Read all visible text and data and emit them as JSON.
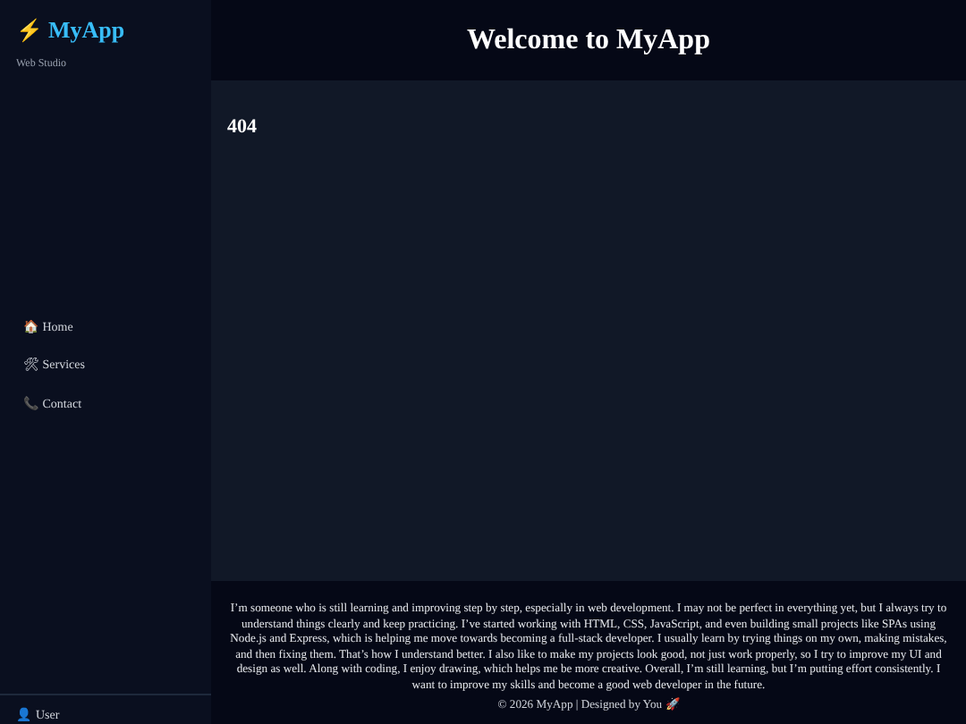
{
  "sidebar": {
    "logo_icon": "⚡",
    "logo": "MyApp",
    "tagline": "Web Studio",
    "items": [
      {
        "icon": "🏠",
        "label": "Home"
      },
      {
        "icon": "🛠",
        "label": "Services"
      },
      {
        "icon": "📞",
        "label": "Contact"
      }
    ],
    "user": {
      "icon": "👤",
      "label": "User"
    }
  },
  "header": {
    "title": "Welcome to MyApp"
  },
  "main": {
    "heading": "404"
  },
  "footer": {
    "about": "I’m someone who is still learning and improving step by step, especially in web development. I may not be perfect in everything yet, but I always try to understand things clearly and keep practicing. I’ve started working with HTML, CSS, JavaScript, and even building small projects like SPAs using Node.js and Express, which is helping me move towards becoming a full-stack developer. I usually learn by trying things on my own, making mistakes, and then fixing them. That’s how I understand better. I also like to make my projects look good, not just work properly, so I try to improve my UI and design as well. Along with coding, I enjoy drawing, which helps me be more creative. Overall, I’m still learning, but I’m putting effort consistently. I want to improve my skills and become a good web developer in the future.",
    "copyright": "© 2026 MyApp | Designed by You 🚀"
  }
}
